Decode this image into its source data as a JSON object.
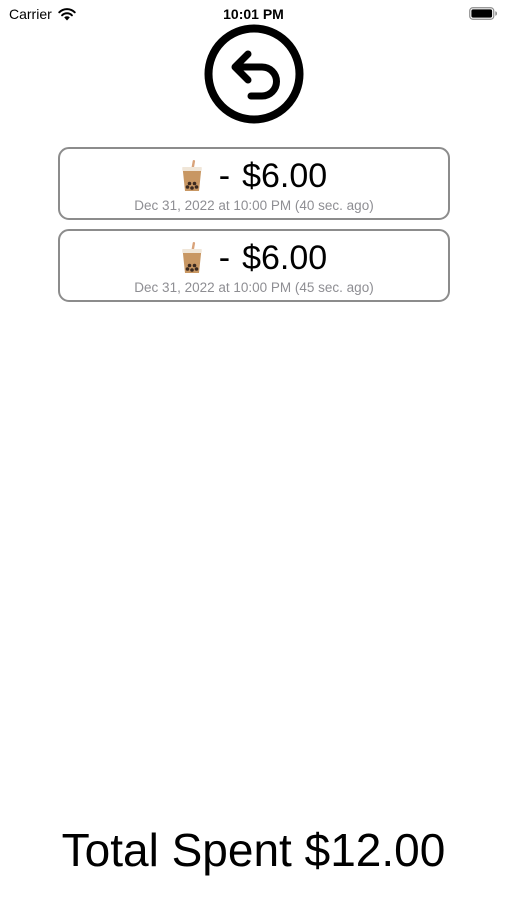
{
  "status_bar": {
    "carrier": "Carrier",
    "time": "10:01 PM",
    "icons": [
      "wifi-icon",
      "battery-icon"
    ]
  },
  "back_button": {
    "icon": "undo-arrow-icon"
  },
  "purchases": [
    {
      "icon": "bubble-tea-icon",
      "separator": "-",
      "amount": "$6.00",
      "date": "Dec 31, 2022 at 10:00 PM (40 sec. ago)"
    },
    {
      "icon": "bubble-tea-icon",
      "separator": "-",
      "amount": "$6.00",
      "date": "Dec 31, 2022 at 10:00 PM (45 sec. ago)"
    }
  ],
  "total": {
    "text": "Total Spent $12.00"
  },
  "colors": {
    "card_border": "#8c8c8c",
    "secondary_text": "#8e8e93",
    "tea": "#c89763",
    "pearls": "#3b2a20"
  }
}
